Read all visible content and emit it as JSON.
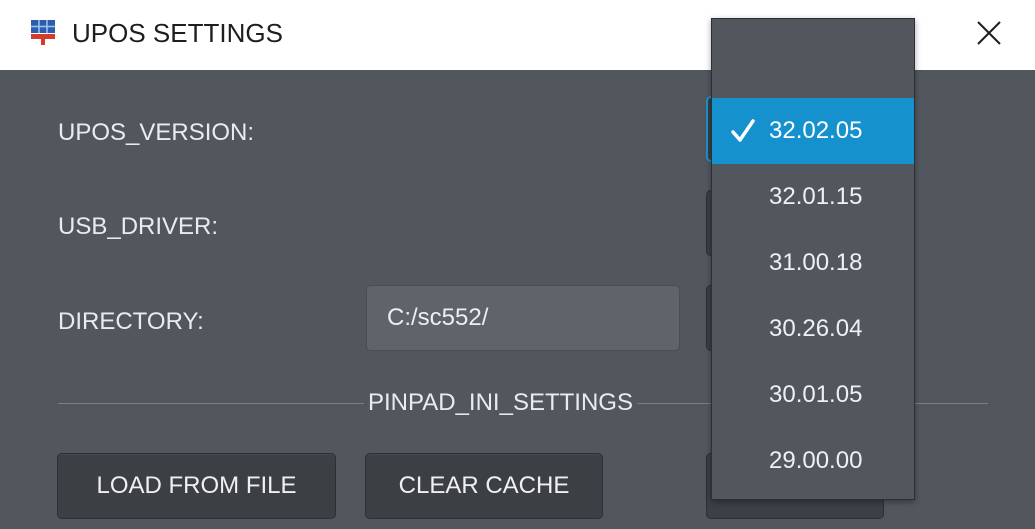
{
  "window": {
    "title": "UPOS SETTINGS",
    "close_symbol": "✕"
  },
  "form": {
    "upos_version_label": "UPOS_VERSION:",
    "usb_driver_label": "USB_DRIVER:",
    "directory_label": "DIRECTORY:",
    "directory_value": "C:/sc552/",
    "section_label": "PINPAD_INI_SETTINGS"
  },
  "buttons": {
    "load_from_file": "LOAD FROM FILE",
    "clear_cache": "CLEAR CACHE"
  },
  "version_dropdown": {
    "options": [
      "32.02.05",
      "32.01.15",
      "31.00.18",
      "30.26.04",
      "30.01.05",
      "29.00.00"
    ],
    "selected": "32.02.05"
  },
  "colors": {
    "accent": "#1591ce",
    "background": "#52575e",
    "button": "#3c4045"
  }
}
